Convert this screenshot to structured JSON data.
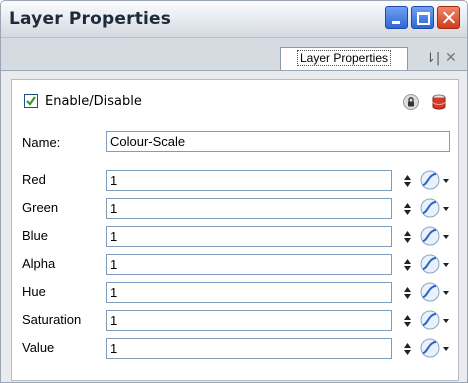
{
  "window": {
    "title": "Layer Properties"
  },
  "tab": {
    "label": "Layer Properties",
    "menu_glyph": "⇂|",
    "close_glyph": "✕"
  },
  "enable": {
    "label": "Enable/Disable",
    "checked": true
  },
  "name": {
    "label": "Name:",
    "value": "Colour-Scale"
  },
  "rows": [
    {
      "label": "Red",
      "value": "1"
    },
    {
      "label": "Green",
      "value": "1"
    },
    {
      "label": "Blue",
      "value": "1"
    },
    {
      "label": "Alpha",
      "value": "1"
    },
    {
      "label": "Hue",
      "value": "1"
    },
    {
      "label": "Saturation",
      "value": "1"
    },
    {
      "label": "Value",
      "value": "1"
    }
  ],
  "icons": {
    "lock": "lock-icon",
    "database": "database-icon",
    "spinner": "spinner-arrows-icon",
    "curve": "function-curve-icon"
  },
  "colors": {
    "checkbox_mark": "#2e9e2e",
    "field_border": "#7f9db9",
    "close_button": "#cf3d1f",
    "title_buttons": "#2f66d6"
  }
}
